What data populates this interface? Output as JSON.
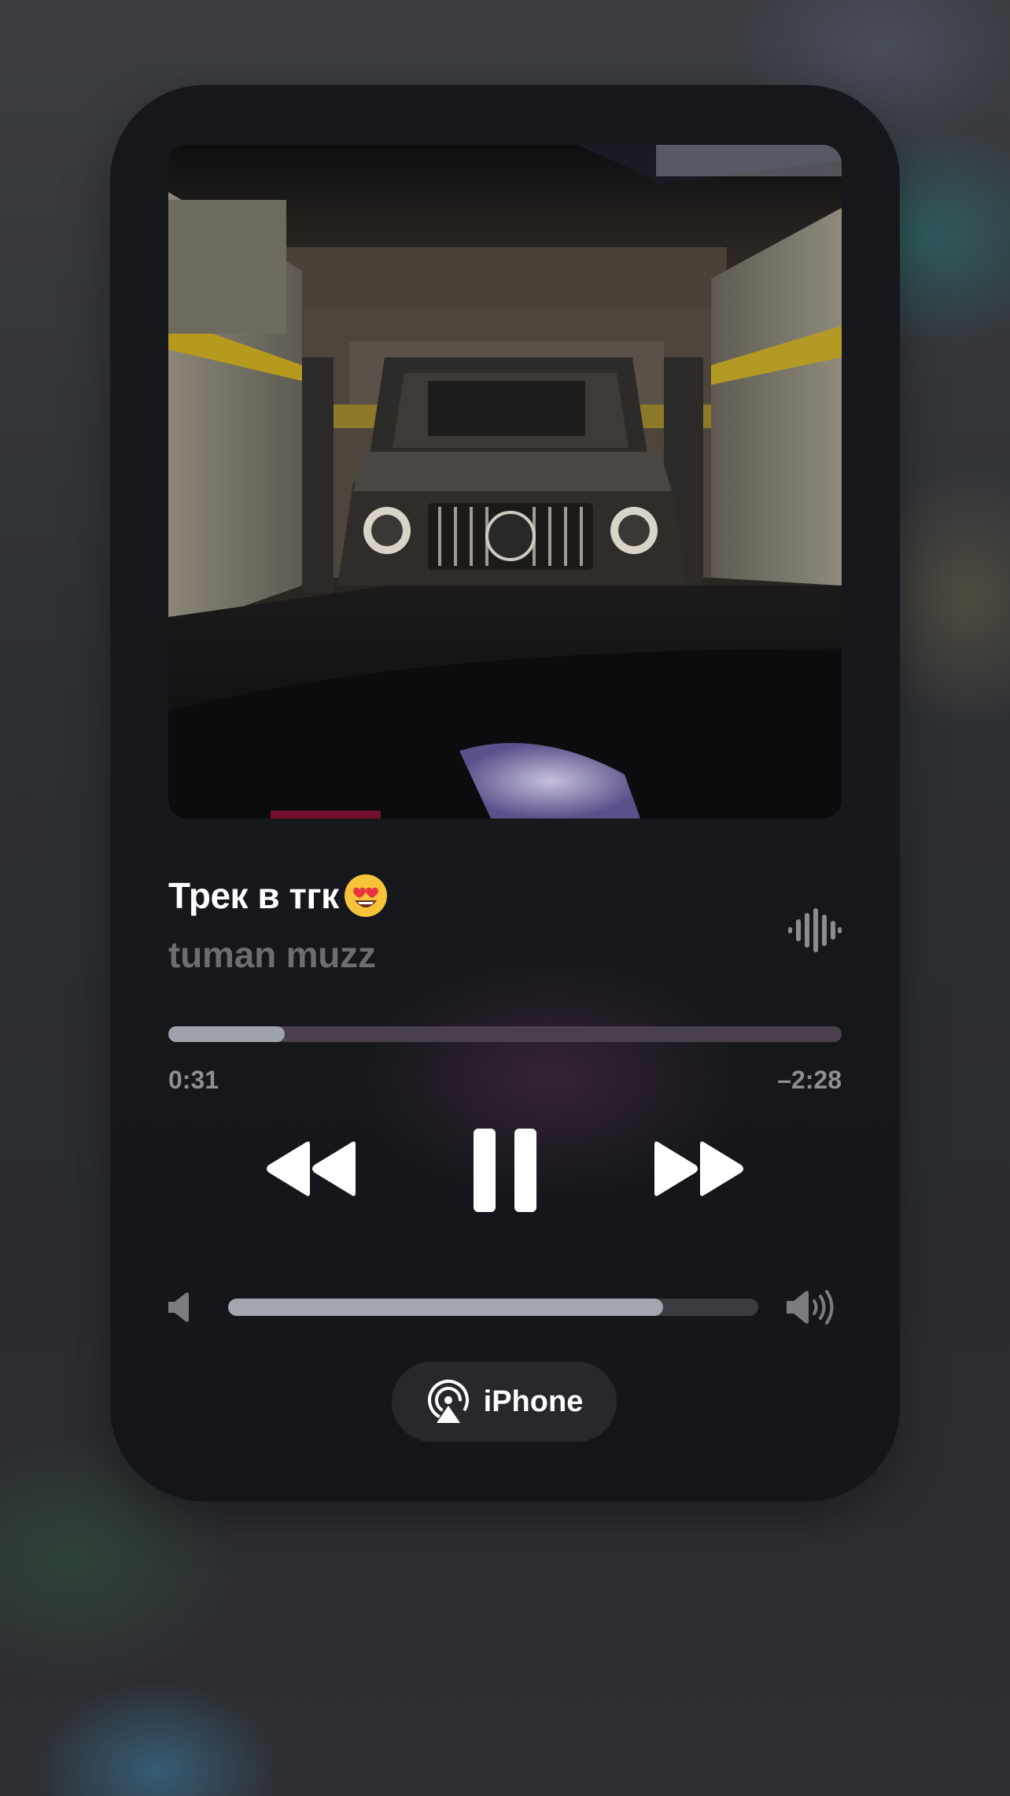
{
  "now_playing": {
    "title": "Трек в тгк",
    "title_emoji": "heart-eyes-emoji",
    "artist": "tuman muzz"
  },
  "progress": {
    "elapsed": "0:31",
    "remaining": "–2:28",
    "fraction": 0.173
  },
  "controls": {
    "previous_icon": "backward-icon",
    "pause_icon": "pause-icon",
    "next_icon": "forward-icon"
  },
  "volume": {
    "level": 0.82,
    "low_icon": "speaker-low-icon",
    "high_icon": "speaker-high-icon"
  },
  "output": {
    "device_label": "iPhone",
    "icon": "airplay-icon"
  },
  "colors": {
    "accent_text": "#ffffff",
    "secondary_text": "#6b6d72",
    "progress_fill": "#9ea2ab",
    "progress_track": "#4a3f4c"
  }
}
